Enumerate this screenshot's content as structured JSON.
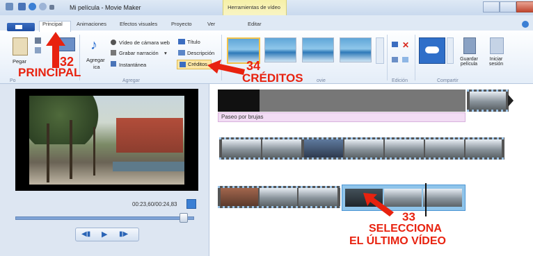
{
  "window": {
    "title": "Mi película - Movie Maker",
    "context_tab_group": "Herramientas de vídeo"
  },
  "tabs": [
    {
      "label": "Principal"
    },
    {
      "label": "Animaciones"
    },
    {
      "label": "Efectos visuales"
    },
    {
      "label": "Proyecto"
    },
    {
      "label": "Ver"
    },
    {
      "label": "Editar"
    }
  ],
  "ribbon": {
    "paste_label": "Pegar",
    "add_videos_label": "Agregar",
    "add_videos_label2": "ica",
    "webcam_label": "Vídeo de cámara web",
    "narration_label": "Grabar narración",
    "snapshot_label": "Instantánea",
    "title_label": "Título",
    "description_label": "Descripción",
    "credits_label": "Créditos",
    "rotate_group": "Edición",
    "share_group": "Compartir",
    "save_movie_label": "Guardar película",
    "signin_label": "Iniciar sesión",
    "group_clipboard": "Po",
    "group_add": "Agregar",
    "group_themes": "ovie"
  },
  "player": {
    "time": "00:23,60/00:24,83"
  },
  "storyboard": {
    "caption": "Paseo por brujas"
  },
  "annotations": {
    "a32_num": "32",
    "a32_text": "PRINCIPAL",
    "a34_num": "34",
    "a34_text": "CRÉDITOS",
    "a33_num": "33",
    "a33_text1": "SELECCIONA",
    "a33_text2": "EL ÚLTIMO VÍDEO"
  },
  "colors": {
    "annotation": "#e8220f",
    "ribbon_bg": "#e4edf8",
    "caption_bg": "#f2dcf4",
    "context_tab": "#f6f0a8"
  }
}
